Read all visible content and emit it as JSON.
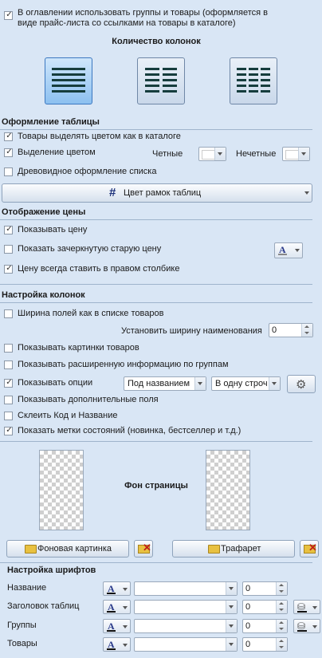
{
  "top": {
    "toc_checkbox_label": "В оглавлении использовать группы и товары (оформляется в виде прайс-листа со ссылками на товары в каталоге)",
    "toc_checked": true
  },
  "columns": {
    "title": "Количество колонок",
    "options": [
      "1",
      "2",
      "3"
    ],
    "selected": "1"
  },
  "table_design": {
    "title": "Оформление таблицы",
    "highlight_like_catalog": "Товары выделять цветом как в каталоге",
    "highlight_color": "Выделение цветом",
    "even_label": "Четные",
    "odd_label": "Нечетные",
    "tree_view": "Древовидное оформление списка",
    "border_color_button": "Цвет рамок таблиц"
  },
  "price": {
    "title": "Отображение цены",
    "show_price": "Показывать цену",
    "show_old_price": "Показать зачеркнутую старую цену",
    "price_right_column": "Цену всегда ставить в правом столбике"
  },
  "columns_setup": {
    "title": "Настройка колонок",
    "field_width_like_list": "Ширина полей как в списке товаров",
    "name_width_label": "Установить ширину наименования",
    "name_width_value": "0",
    "show_images": "Показывать картинки товаров",
    "show_extended_groups": "Показывать расширенную информацию по группам",
    "show_options": "Показывать опции",
    "options_position": "Под названием",
    "options_layout": "В одну строч",
    "show_extra_fields": "Показывать дополнительные поля",
    "merge_code_name": "Склеить Код и Название",
    "show_status_marks": "Показать метки состояний (новинка, бестселлер и т.д.)"
  },
  "background": {
    "title": "Фон страницы",
    "bg_image_button": "Фоновая картинка",
    "stencil_button": "Трафарет"
  },
  "fonts": {
    "title": "Настройка шрифтов",
    "rows": [
      {
        "label": "Название",
        "value": "0"
      },
      {
        "label": "Заголовок таблиц",
        "value": "0"
      },
      {
        "label": "Группы",
        "value": "0"
      },
      {
        "label": "Товары",
        "value": "0"
      }
    ]
  },
  "colors": {
    "background": "#d9e6f5",
    "accent": "#3c78c0",
    "line": "#9fb4cc"
  }
}
